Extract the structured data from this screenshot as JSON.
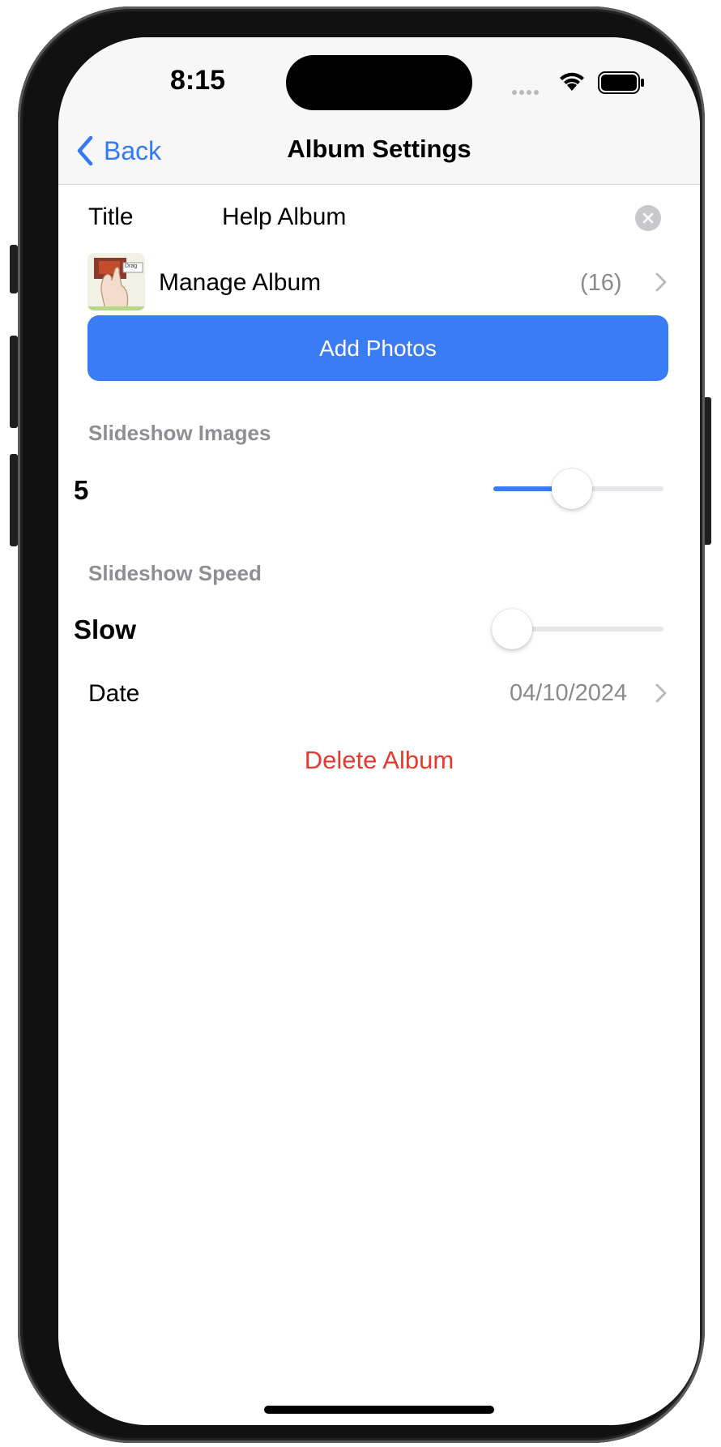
{
  "status_bar": {
    "time": "8:15",
    "icons": [
      "signal-dots-icon",
      "wifi-icon",
      "battery-icon"
    ]
  },
  "nav": {
    "back_label": "Back",
    "title": "Album Settings"
  },
  "title_field": {
    "label": "Title",
    "value": "Help Album"
  },
  "manage_album": {
    "label": "Manage Album",
    "count": "(16)"
  },
  "add_photos": {
    "label": "Add Photos"
  },
  "slideshow_images": {
    "label": "Slideshow Images",
    "value": "5",
    "slider_level": 0.46
  },
  "slideshow_speed": {
    "label": "Slideshow Speed",
    "value": "Slow",
    "slider_level": 0.0
  },
  "date": {
    "label": "Date",
    "value": "04/10/2024"
  },
  "delete_album": {
    "label": "Delete Album"
  },
  "thumbnail": {
    "caption": "Drag"
  },
  "colors": {
    "accent": "#3a7cf4",
    "destructive": "#e53a30",
    "secondary_text": "#8e8e93"
  }
}
